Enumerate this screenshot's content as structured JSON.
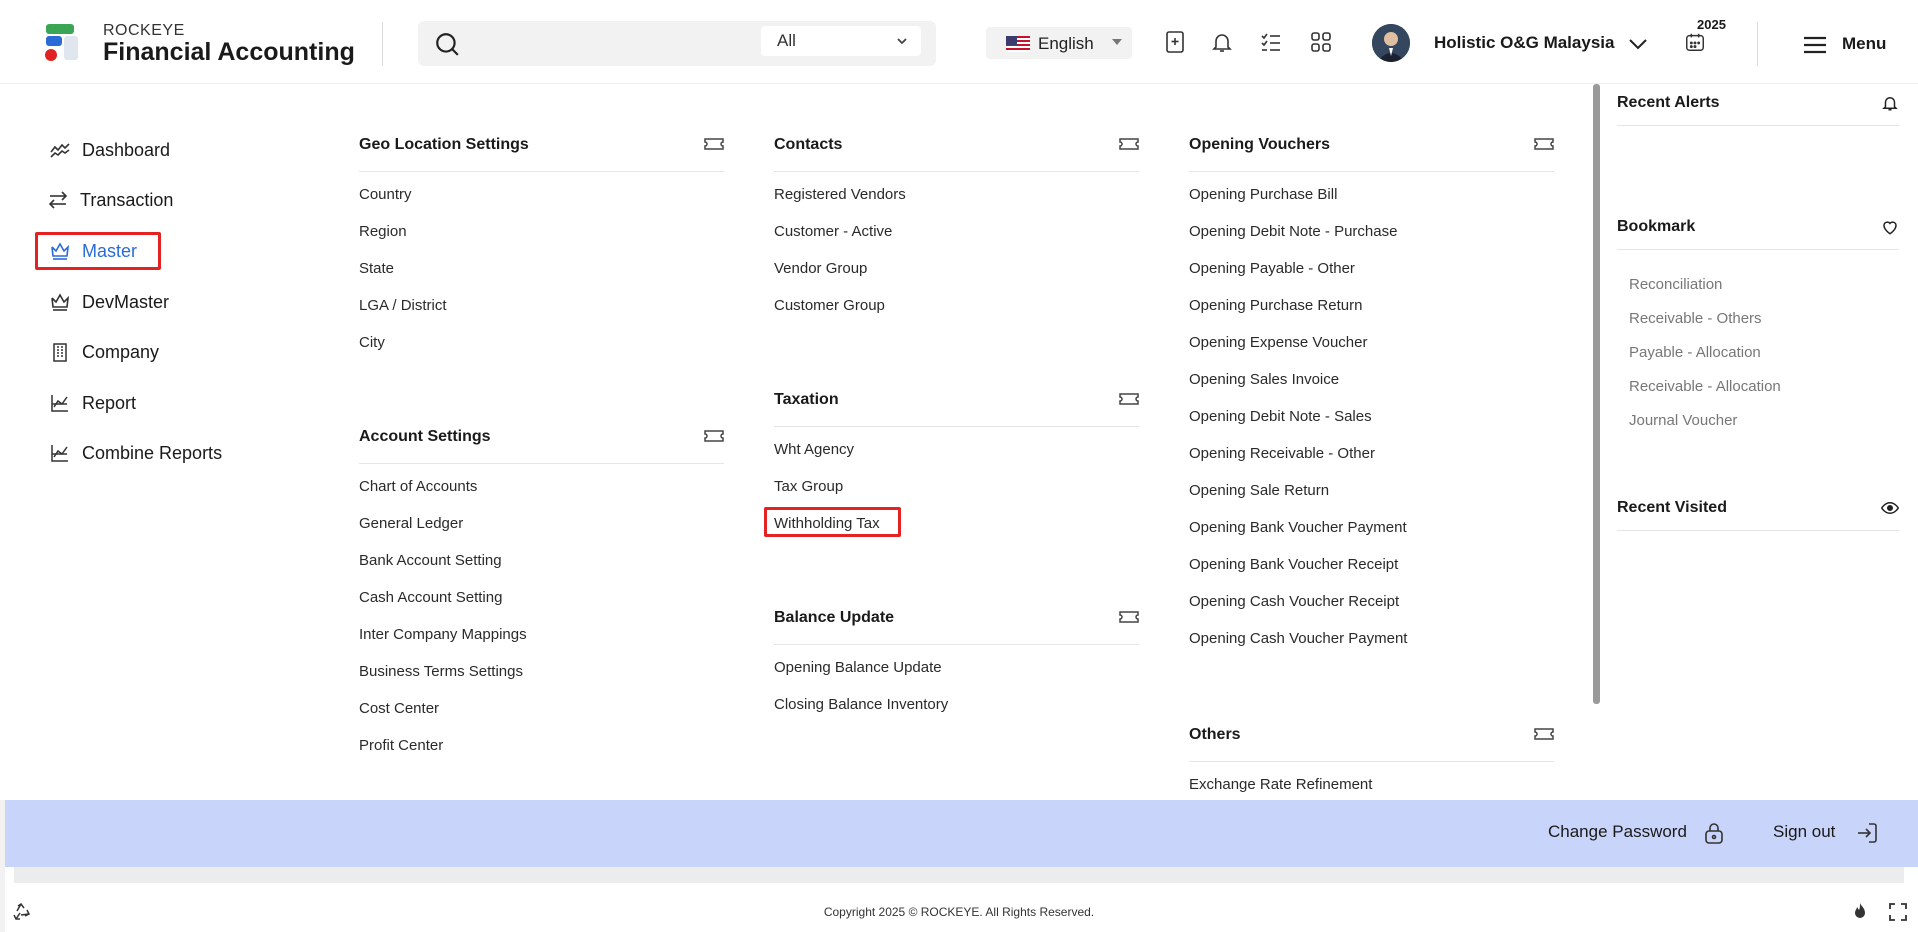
{
  "app": {
    "brand_small": "ROCKEYE",
    "brand_title": "Financial Accounting"
  },
  "search": {
    "placeholder": "",
    "filter_selected": "All"
  },
  "language": {
    "selected": "English"
  },
  "user": {
    "company": "Holistic O&G Malaysia"
  },
  "fiscal": {
    "year": "2025"
  },
  "menu": {
    "label": "Menu"
  },
  "sidebar": {
    "items": [
      {
        "label": "Dashboard",
        "icon": "chart-line-icon"
      },
      {
        "label": "Transaction",
        "icon": "arrows-exchange-icon"
      },
      {
        "label": "Master",
        "icon": "crown-icon",
        "active": true
      },
      {
        "label": "DevMaster",
        "icon": "crown-icon"
      },
      {
        "label": "Company",
        "icon": "building-icon"
      },
      {
        "label": "Report",
        "icon": "report-chart-icon"
      },
      {
        "label": "Combine Reports",
        "icon": "report-chart-icon"
      }
    ]
  },
  "mega": {
    "geo": {
      "title": "Geo Location Settings",
      "links": [
        "Country",
        "Region",
        "State",
        "LGA / District",
        "City"
      ]
    },
    "account": {
      "title": "Account Settings",
      "links": [
        "Chart of Accounts",
        "General Ledger",
        "Bank Account Setting",
        "Cash Account Setting",
        "Inter Company Mappings",
        "Business Terms Settings",
        "Cost Center",
        "Profit Center"
      ]
    },
    "contacts": {
      "title": "Contacts",
      "links": [
        "Registered Vendors",
        "Customer - Active",
        "Vendor Group",
        "Customer Group"
      ]
    },
    "taxation": {
      "title": "Taxation",
      "links": [
        "Wht Agency",
        "Tax Group",
        "Withholding Tax"
      ]
    },
    "balance": {
      "title": "Balance Update",
      "links": [
        "Opening Balance Update",
        "Closing Balance Inventory"
      ]
    },
    "opening": {
      "title": "Opening Vouchers",
      "links": [
        "Opening Purchase Bill",
        "Opening Debit Note - Purchase",
        "Opening Payable - Other",
        "Opening Purchase Return",
        "Opening Expense Voucher",
        "Opening Sales Invoice",
        "Opening Debit Note - Sales",
        "Opening Receivable - Other",
        "Opening Sale Return",
        "Opening Bank Voucher Payment",
        "Opening Bank Voucher Receipt",
        "Opening Cash Voucher Receipt",
        "Opening Cash Voucher Payment"
      ]
    },
    "others": {
      "title": "Others",
      "links": [
        "Exchange Rate Refinement"
      ]
    }
  },
  "right": {
    "alerts_title": "Recent Alerts",
    "bookmark_title": "Bookmark",
    "bookmarks": [
      "Reconciliation",
      "Receivable - Others",
      "Payable - Allocation",
      "Receivable - Allocation",
      "Journal Voucher"
    ],
    "visited_title": "Recent Visited"
  },
  "footer": {
    "change_password": "Change Password",
    "sign_out": "Sign out",
    "copyright": "Copyright 2025 © ROCKEYE. All Rights Reserved."
  },
  "colors": {
    "accent": "#2a6bd8",
    "highlight": "#e52222",
    "footer_bar": "#c8d4fa"
  }
}
